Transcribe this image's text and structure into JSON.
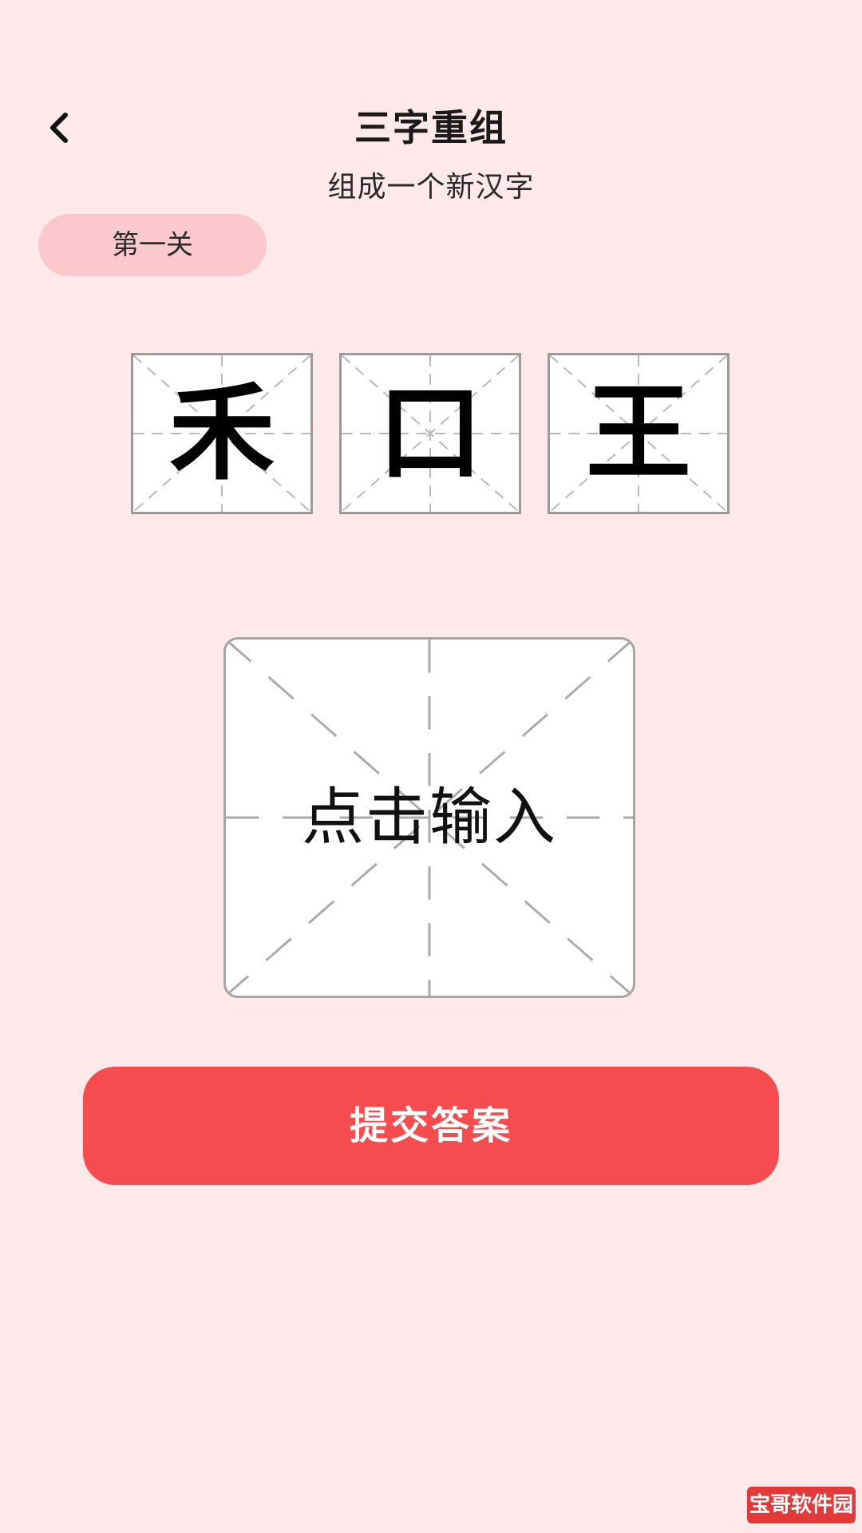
{
  "header": {
    "back_icon": "chevron-left-icon",
    "title": "三字重组",
    "subtitle": "组成一个新汉字"
  },
  "level": {
    "label": "第一关"
  },
  "characters": [
    {
      "char": "禾"
    },
    {
      "char": "口"
    },
    {
      "char": "王"
    }
  ],
  "answer_input": {
    "placeholder": "点击输入"
  },
  "submit": {
    "label": "提交答案"
  },
  "watermark": {
    "text": "宝哥软件园"
  },
  "colors": {
    "background": "#fde8ea",
    "badge": "#f9c9cd",
    "submit_button": "#f64b4f",
    "grid_line": "#b0b0b0"
  }
}
